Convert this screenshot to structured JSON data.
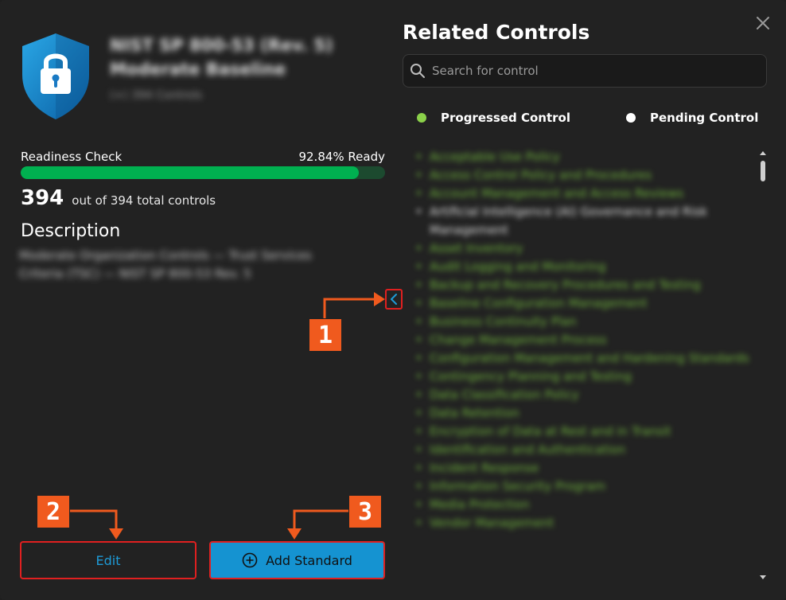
{
  "standard": {
    "title": "NIST SP 800-53 (Rev. 5) Moderate Baseline",
    "subtitle": "(+) 394 Controls"
  },
  "readiness": {
    "label": "Readiness Check",
    "percent_text": "92.84% Ready",
    "progress_fraction": 0.9284,
    "count": "394",
    "count_text": "out of 394 total controls"
  },
  "description": {
    "heading": "Description",
    "text": "Moderate Organization Controls — Trust Services Criteria (TSC) — NIST SP 800-53 Rev. 5"
  },
  "right_panel": {
    "title": "Related Controls",
    "search_placeholder": "Search for control",
    "legend": [
      {
        "label": "Progressed Control",
        "color": "#8bd14a"
      },
      {
        "label": "Pending Control",
        "color": "#ffffff"
      }
    ],
    "controls": [
      {
        "label": "Acceptable Use Policy",
        "status": "progressed"
      },
      {
        "label": "Access Control Policy and Procedures",
        "status": "progressed"
      },
      {
        "label": "Account Management and Access Reviews",
        "status": "progressed"
      },
      {
        "label": "Artificial Intelligence (AI) Governance and Risk Management",
        "status": "pending"
      },
      {
        "label": "Asset Inventory",
        "status": "progressed"
      },
      {
        "label": "Audit Logging and Monitoring",
        "status": "progressed"
      },
      {
        "label": "Backup and Recovery Procedures and Testing",
        "status": "progressed"
      },
      {
        "label": "Baseline Configuration Management",
        "status": "progressed"
      },
      {
        "label": "Business Continuity Plan",
        "status": "progressed"
      },
      {
        "label": "Change Management Process",
        "status": "progressed"
      },
      {
        "label": "Configuration Management and Hardening Standards",
        "status": "progressed"
      },
      {
        "label": "Contingency Planning and Testing",
        "status": "progressed"
      },
      {
        "label": "Data Classification Policy",
        "status": "progressed"
      },
      {
        "label": "Data Retention",
        "status": "progressed"
      },
      {
        "label": "Encryption of Data at Rest and in Transit",
        "status": "progressed"
      },
      {
        "label": "Identification and Authentication",
        "status": "progressed"
      },
      {
        "label": "Incident Response",
        "status": "progressed"
      },
      {
        "label": "Information Security Program",
        "status": "progressed"
      },
      {
        "label": "Media Protection",
        "status": "progressed"
      },
      {
        "label": "Vendor Management",
        "status": "progressed"
      }
    ]
  },
  "buttons": {
    "edit": "Edit",
    "add_standard": "Add Standard"
  },
  "annotations": {
    "one": "1",
    "two": "2",
    "three": "3"
  },
  "colors": {
    "accent": "#1593d1",
    "progress": "#00b050",
    "annotation": "#f05a1e",
    "highlight": "#e02020"
  },
  "icons": {
    "shield": "shield-lock-icon",
    "close": "close-icon",
    "search": "search-icon",
    "collapse": "chevron-left-icon",
    "add": "plus-circle-icon"
  }
}
